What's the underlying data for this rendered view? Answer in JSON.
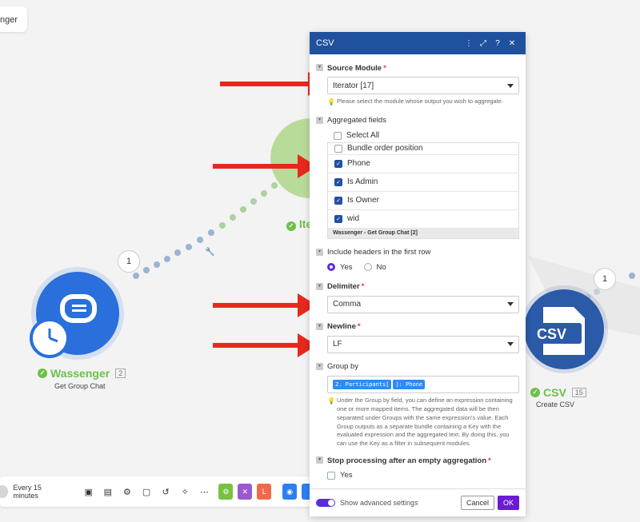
{
  "canvas": {
    "top_chip_text": "nger",
    "wassenger": {
      "name": "Wassenger",
      "count": "2",
      "subtitle": "Get Group Chat"
    },
    "iterator": {
      "name_partial": "Ite"
    },
    "csv_module": {
      "name": "CSV",
      "count": "15",
      "subtitle": "Create CSV",
      "icon_text": "CSV"
    },
    "bubble_left": "1",
    "bubble_right": "1"
  },
  "toolbar": {
    "schedule_label": "Every 15 minutes",
    "buttons": [
      "save-icon",
      "layout-icon",
      "settings-icon",
      "notes-icon",
      "undo-icon",
      "magic-wand-icon",
      "more-icon"
    ]
  },
  "panel": {
    "title": "CSV",
    "source_module": {
      "label": "Source Module",
      "value": "Iterator [17]",
      "hint": "Please select the module whose output you wish to aggregate."
    },
    "aggregated_fields": {
      "label": "Aggregated fields",
      "select_all": "Select All",
      "fields": [
        {
          "label": "Bundle order position",
          "checked": false
        },
        {
          "label": "Phone",
          "checked": true
        },
        {
          "label": "Is Admin",
          "checked": true
        },
        {
          "label": "Is Owner",
          "checked": true
        },
        {
          "label": "wid",
          "checked": true
        }
      ],
      "footer": "Wassenger - Get Group Chat [2]"
    },
    "include_headers": {
      "label": "Include headers in the first row",
      "yes": "Yes",
      "no": "No",
      "selected": "Yes"
    },
    "delimiter": {
      "label": "Delimiter",
      "value": "Comma"
    },
    "newline": {
      "label": "Newline",
      "value": "LF"
    },
    "group_by": {
      "label": "Group by",
      "pill1": "2. Participants[",
      "pill2": "]: Phone",
      "hint": "Under the Group by field, you can define an expression containing one or more mapped items. The aggregated data will be then separated under Groups with the same expression's value. Each Group outputs as a separate bundle containing a Key with the evaluated expression and the aggregated text. By doing this, you can use the Key as a filter in subsequent modules."
    },
    "stop_processing": {
      "label": "Stop processing after an empty aggregation",
      "option": "Yes"
    },
    "footer": {
      "advanced": "Show advanced settings",
      "cancel": "Cancel",
      "ok": "OK"
    }
  },
  "colors": {
    "header": "#20519f",
    "accent": "#5b2be0",
    "ok": "#6a1bd8",
    "arrow": "#e8281c",
    "success": "#6cc04a"
  }
}
